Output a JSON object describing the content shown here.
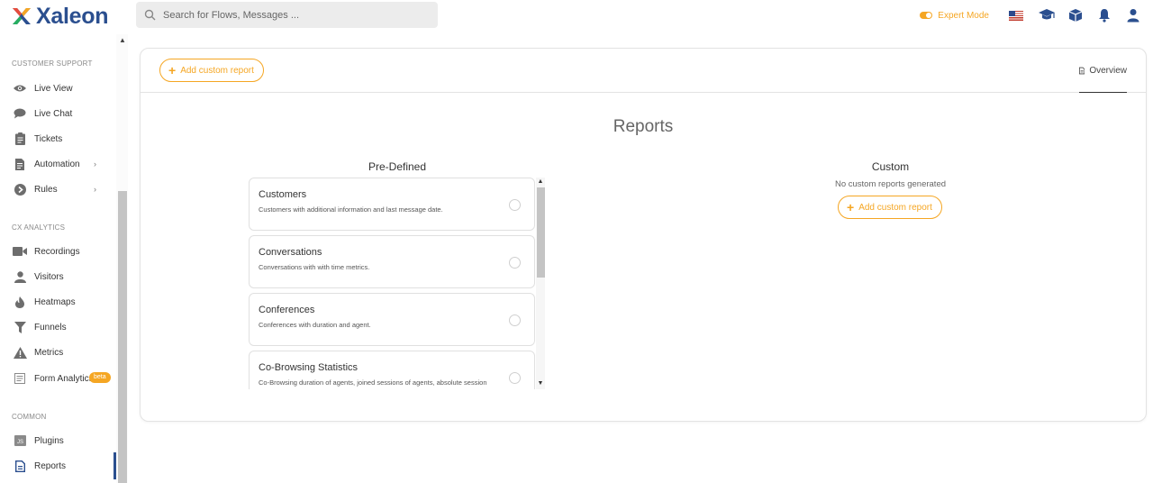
{
  "app": {
    "name": "Xaleon"
  },
  "search": {
    "placeholder": "Search for Flows, Messages ..."
  },
  "topbar": {
    "expert_mode": "Expert Mode"
  },
  "sidebar": {
    "sections": [
      {
        "title": "CUSTOMER SUPPORT",
        "items": [
          {
            "label": "Live View",
            "icon": "eye-icon"
          },
          {
            "label": "Live Chat",
            "icon": "chat-bubble-icon"
          },
          {
            "label": "Tickets",
            "icon": "clipboard-icon"
          },
          {
            "label": "Automation",
            "icon": "document-icon",
            "has_submenu": true
          },
          {
            "label": "Rules",
            "icon": "circle-arrow-icon",
            "has_submenu": true
          }
        ]
      },
      {
        "title": "CX ANALYTICS",
        "items": [
          {
            "label": "Recordings",
            "icon": "video-camera-icon"
          },
          {
            "label": "Visitors",
            "icon": "user-icon"
          },
          {
            "label": "Heatmaps",
            "icon": "flame-icon"
          },
          {
            "label": "Funnels",
            "icon": "funnel-icon"
          },
          {
            "label": "Metrics",
            "icon": "warning-triangle-icon"
          },
          {
            "label": "Form Analytics",
            "icon": "form-icon",
            "badge": "beta"
          }
        ]
      },
      {
        "title": "COMMON",
        "items": [
          {
            "label": "Plugins",
            "icon": "js-icon"
          },
          {
            "label": "Reports",
            "icon": "report-document-icon",
            "active": true
          }
        ]
      }
    ]
  },
  "header": {
    "add_custom_report": "Add custom report",
    "tab_overview": "Overview"
  },
  "main": {
    "title": "Reports",
    "predefined": {
      "title": "Pre-Defined",
      "reports": [
        {
          "name": "Customers",
          "description": "Customers with additional information and last message date."
        },
        {
          "name": "Conversations",
          "description": "Conversations with with time metrics."
        },
        {
          "name": "Conferences",
          "description": "Conferences with duration and agent."
        },
        {
          "name": "Co-Browsing Statistics",
          "description": "Co-Browsing duration of agents, joined sessions of agents, absolute session"
        }
      ]
    },
    "custom": {
      "title": "Custom",
      "empty_text": "No custom reports generated",
      "add_button": "Add custom report"
    }
  },
  "colors": {
    "accent": "#f5a623",
    "brand": "#2b4f8f"
  }
}
